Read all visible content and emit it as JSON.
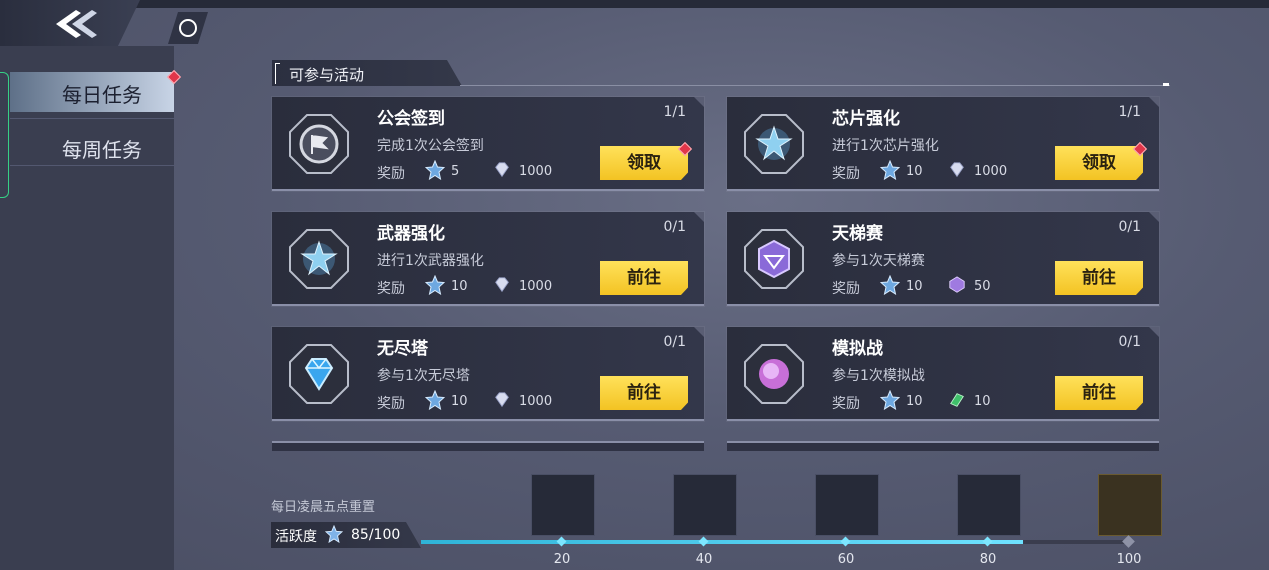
{
  "sidebar": {
    "items": [
      {
        "label": "每日任务",
        "active": true
      },
      {
        "label": "每周任务",
        "active": false
      }
    ]
  },
  "section": {
    "title": "可参与活动"
  },
  "reward_label": "奖励",
  "tasks": [
    {
      "title": "公会签到",
      "progress": "1/1",
      "desc": "完成1次公会签到",
      "reward1": "5",
      "reward2": "1000",
      "button": "领取",
      "claimable": true,
      "icon": "guild-flag-icon",
      "reward2_icon": "diamond-icon"
    },
    {
      "title": "芯片强化",
      "progress": "1/1",
      "desc": "进行1次芯片强化",
      "reward1": "10",
      "reward2": "1000",
      "button": "领取",
      "claimable": true,
      "icon": "chip-star-icon",
      "reward2_icon": "diamond-icon"
    },
    {
      "title": "武器强化",
      "progress": "0/1",
      "desc": "进行1次武器强化",
      "reward1": "10",
      "reward2": "1000",
      "button": "前往",
      "claimable": false,
      "icon": "weapon-star-icon",
      "reward2_icon": "diamond-icon"
    },
    {
      "title": "天梯赛",
      "progress": "0/1",
      "desc": "参与1次天梯赛",
      "reward1": "10",
      "reward2": "50",
      "button": "前往",
      "claimable": false,
      "icon": "ladder-crystal-icon",
      "reward2_icon": "purple-crystal-icon"
    },
    {
      "title": "无尽塔",
      "progress": "0/1",
      "desc": "参与1次无尽塔",
      "reward1": "10",
      "reward2": "1000",
      "button": "前往",
      "claimable": false,
      "icon": "blue-diamond-icon",
      "reward2_icon": "diamond-icon"
    },
    {
      "title": "模拟战",
      "progress": "0/1",
      "desc": "参与1次模拟战",
      "reward1": "10",
      "reward2": "10",
      "button": "前往",
      "claimable": false,
      "icon": "simulation-puzzle-icon",
      "reward2_icon": "green-ticket-icon"
    }
  ],
  "footer": {
    "reset_note": "每日凌晨五点重置",
    "activity_label": "活跃度",
    "activity_value": "85/100",
    "activity_fraction": 0.85,
    "milestones": [
      "20",
      "40",
      "60",
      "80",
      "100"
    ]
  },
  "colors": {
    "accent_yellow": "#f3c323",
    "progress_cyan": "#2fb4d8",
    "active_tab": "#c8d4e6",
    "alert_red": "#e0364a"
  }
}
